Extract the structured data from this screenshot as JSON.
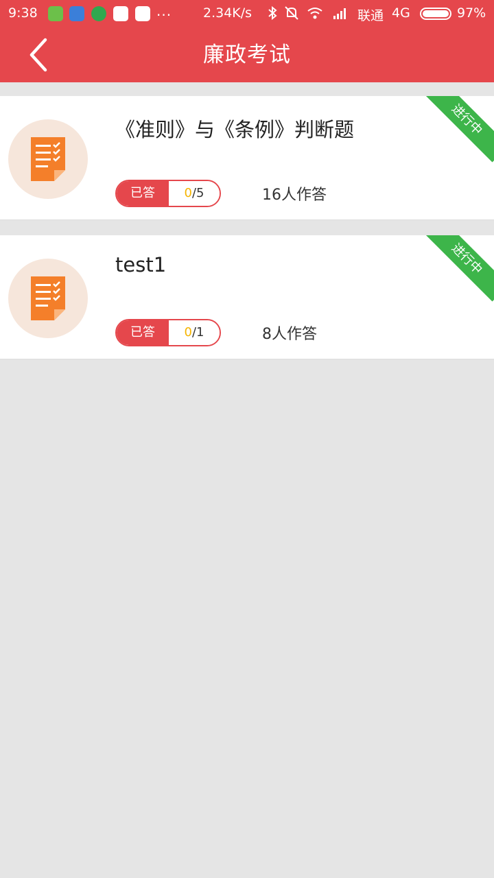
{
  "status_bar": {
    "time": "9:38",
    "more": "...",
    "net_speed": "2.34K/s",
    "carrier": "联通",
    "network": "4G",
    "battery": "97%",
    "icons": [
      "shield-app-icon",
      "doc-app-icon",
      "globe-app-icon",
      "photo-app-icon",
      "photo-app-icon",
      "bluetooth-icon",
      "mute-icon",
      "wifi-icon",
      "signal-icon",
      "battery-icon"
    ]
  },
  "header": {
    "title": "廉政考试",
    "back_icon": "chevron-left-icon"
  },
  "exams": [
    {
      "title": "《准则》与《条例》判断题",
      "answered_label": "已答",
      "answered": "0",
      "total": "/5",
      "respondents": "16人作答",
      "status": "进行中"
    },
    {
      "title": "test1",
      "answered_label": "已答",
      "answered": "0",
      "total": "/1",
      "respondents": "8人作答",
      "status": "进行中"
    }
  ],
  "colors": {
    "brand_red": "#e5474c",
    "status_green": "#3db54a",
    "icon_orange": "#f47f2a",
    "answered_yellow": "#f5b400",
    "background": "#e5e5e5"
  }
}
